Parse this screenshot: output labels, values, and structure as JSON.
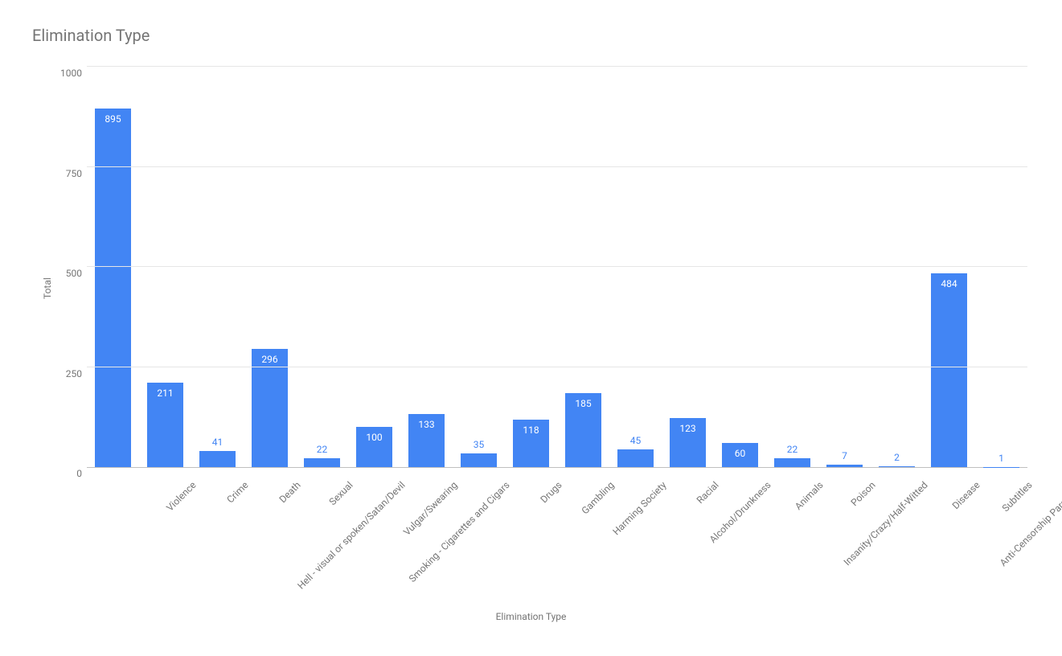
{
  "chart_data": {
    "type": "bar",
    "title": "Elimination Type",
    "xlabel": "Elimination Type",
    "ylabel": "Total",
    "ylim": [
      0,
      1000
    ],
    "yticks": [
      0,
      250,
      500,
      750,
      1000
    ],
    "categories": [
      "Violence",
      "Crime",
      "Death",
      "Sexual",
      "Hell - visual or spoken/Satan/Devil",
      "Vulgar/Swearing",
      "Smoking - Cigarettes and Cigars",
      "Drugs",
      "Gambling",
      "Harming Society",
      "Racial",
      "Alcohol/Drunkness",
      "Animals",
      "Poison",
      "Insanity/Crazy/Half-Witted",
      "Disease",
      "Subtitles",
      "Anti-Censorship Paragraph"
    ],
    "values": [
      895,
      211,
      41,
      296,
      22,
      100,
      133,
      35,
      118,
      185,
      45,
      123,
      60,
      22,
      7,
      2,
      484,
      1
    ],
    "bar_color": "#4285f4"
  }
}
